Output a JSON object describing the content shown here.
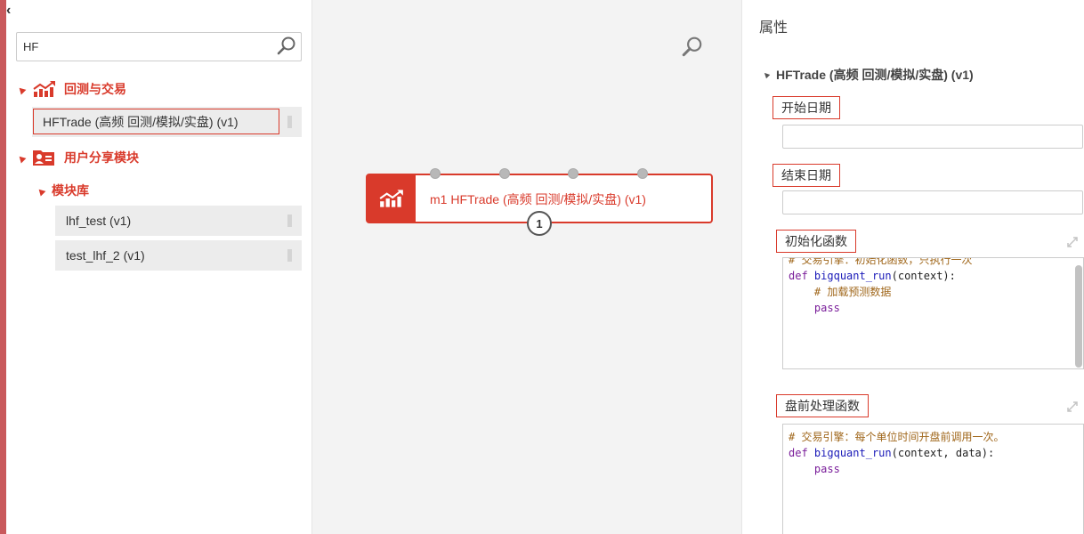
{
  "left_panel": {
    "collapse_glyph": "‹",
    "search": {
      "value": "HF",
      "icon": "search-icon"
    },
    "categories": [
      {
        "label": "回测与交易",
        "icon": "chart-trend-icon",
        "items": [
          {
            "label": "HFTrade (高频 回测/模拟/实盘) (v1)"
          }
        ]
      },
      {
        "label": "用户分享模块",
        "icon": "user-card-icon",
        "subcategory": {
          "label": "模块库",
          "items": [
            {
              "label": "lhf_test (v1)"
            },
            {
              "label": "test_lhf_2 (v1)"
            }
          ]
        }
      }
    ]
  },
  "canvas": {
    "search_icon": "zoom-search-icon",
    "module": {
      "label": "m1 HFTrade (高频 回测/模拟/实盘) (v1)",
      "icon": "chart-trend-icon",
      "output_port": "1"
    }
  },
  "right_panel": {
    "title": "属性",
    "module_title": "HFTrade (高频 回测/模拟/实盘) (v1)",
    "fields": {
      "start_date": {
        "label": "开始日期",
        "value": ""
      },
      "end_date": {
        "label": "结束日期",
        "value": ""
      },
      "init_func": {
        "label": "初始化函数",
        "lines": [
          "# 交易引擎：初始化函数，只执行一次",
          "def bigquant_run(context):",
          "    # 加载预测数据",
          "    pass"
        ]
      },
      "before_trading": {
        "label": "盘前处理函数",
        "lines": [
          "# 交易引擎：每个单位时间开盘前调用一次。",
          "def bigquant_run(context, data):",
          "    pass"
        ]
      }
    }
  },
  "colors": {
    "accent": "#d93a2b",
    "left_bar": "#c9595c",
    "canvas_bg": "#f3f3f3"
  }
}
